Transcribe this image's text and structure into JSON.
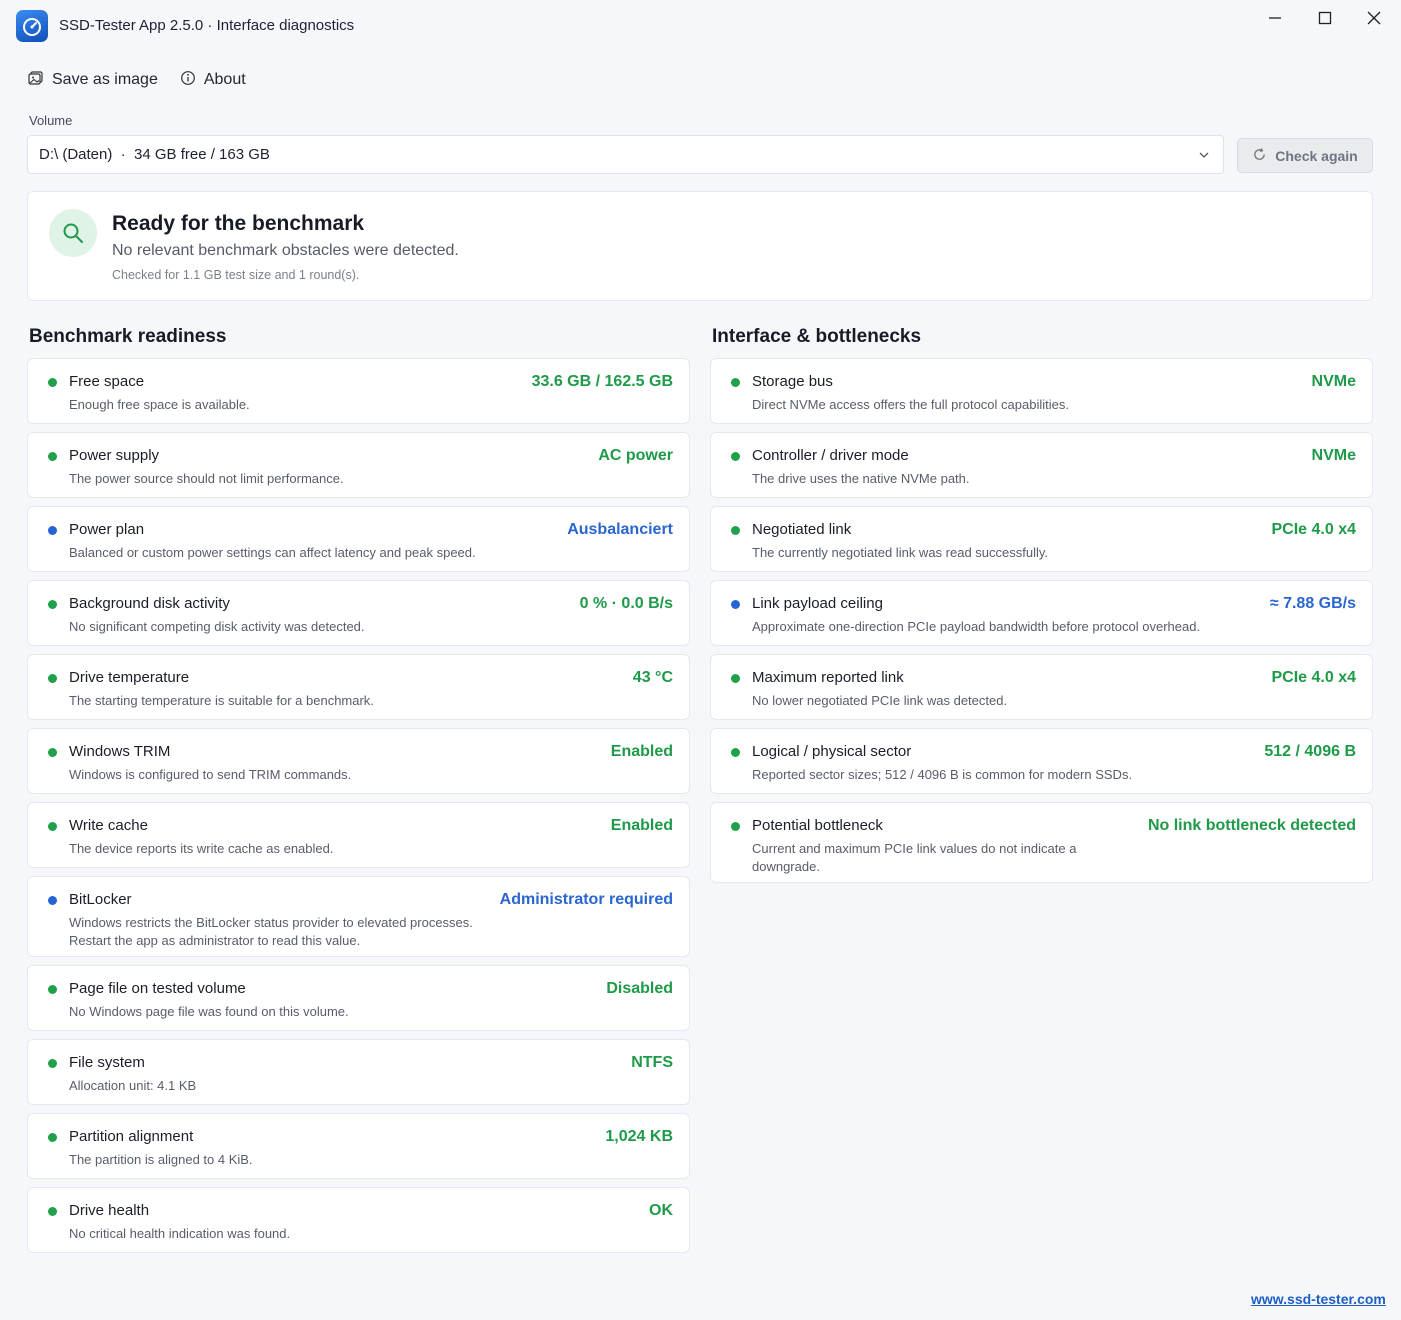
{
  "window": {
    "title": "SSD-Tester App 2.5.0 · Interface diagnostics",
    "icon": "speedometer-icon"
  },
  "menu": {
    "save_label": "Save as image",
    "about_label": "About"
  },
  "volume": {
    "label": "Volume",
    "selected": "D:\\ (Daten)  ·  34 GB free / 163 GB",
    "check_again_label": "Check again"
  },
  "status": {
    "title": "Ready for the benchmark",
    "subtitle": "No relevant benchmark obstacles were detected.",
    "note": "Checked for 1.1 GB test size and 1 round(s)."
  },
  "readiness": {
    "title": "Benchmark readiness",
    "items": [
      {
        "status": "green",
        "title": "Free space",
        "desc": "Enough free space is available.",
        "value": "33.6 GB / 162.5 GB"
      },
      {
        "status": "green",
        "title": "Power supply",
        "desc": "The power source should not limit performance.",
        "value": "AC power"
      },
      {
        "status": "blue",
        "title": "Power plan",
        "desc": "Balanced or custom power settings can affect latency and peak speed.",
        "value": "Ausbalanciert"
      },
      {
        "status": "green",
        "title": "Background disk activity",
        "desc": "No significant competing disk activity was detected.",
        "value": "0 % · 0.0 B/s"
      },
      {
        "status": "green",
        "title": "Drive temperature",
        "desc": "The starting temperature is suitable for a benchmark.",
        "value": "43 °C"
      },
      {
        "status": "green",
        "title": "Windows TRIM",
        "desc": "Windows is configured to send TRIM commands.",
        "value": "Enabled"
      },
      {
        "status": "green",
        "title": "Write cache",
        "desc": "The device reports its write cache as enabled.",
        "value": "Enabled"
      },
      {
        "status": "blue",
        "title": "BitLocker",
        "desc": "Windows restricts the BitLocker status provider to elevated processes. Restart the app as administrator to read this value.",
        "value": "Administrator required"
      },
      {
        "status": "green",
        "title": "Page file on tested volume",
        "desc": "No Windows page file was found on this volume.",
        "value": "Disabled"
      },
      {
        "status": "green",
        "title": "File system",
        "desc": "Allocation unit: 4.1 KB",
        "value": "NTFS"
      },
      {
        "status": "green",
        "title": "Partition alignment",
        "desc": "The partition is aligned to 4 KiB.",
        "value": "1,024 KB"
      },
      {
        "status": "green",
        "title": "Drive health",
        "desc": "No critical health indication was found.",
        "value": "OK"
      }
    ]
  },
  "interface": {
    "title": "Interface & bottlenecks",
    "items": [
      {
        "status": "green",
        "title": "Storage bus",
        "desc": "Direct NVMe access offers the full protocol capabilities.",
        "value": "NVMe"
      },
      {
        "status": "green",
        "title": "Controller / driver mode",
        "desc": "The drive uses the native NVMe path.",
        "value": "NVMe"
      },
      {
        "status": "green",
        "title": "Negotiated link",
        "desc": "The currently negotiated link was read successfully.",
        "value": "PCIe 4.0 x4"
      },
      {
        "status": "blue",
        "title": "Link payload ceiling",
        "desc": "Approximate one-direction PCIe payload bandwidth before protocol overhead.",
        "value": "≈ 7.88 GB/s"
      },
      {
        "status": "green",
        "title": "Maximum reported link",
        "desc": "No lower negotiated PCIe link was detected.",
        "value": "PCIe 4.0 x4"
      },
      {
        "status": "green",
        "title": "Logical / physical sector",
        "desc": "Reported sector sizes; 512 / 4096 B is common for modern SSDs.",
        "value": "512 / 4096 B"
      },
      {
        "status": "green",
        "title": "Potential bottleneck",
        "desc": "Current and maximum PCIe link values do not indicate a downgrade.",
        "value": "No link bottleneck detected"
      }
    ]
  },
  "footer": {
    "link": "www.ssd-tester.com"
  },
  "colors": {
    "ok": "#1f9a48",
    "info": "#2a66cf",
    "background": "#f6f7fb"
  }
}
